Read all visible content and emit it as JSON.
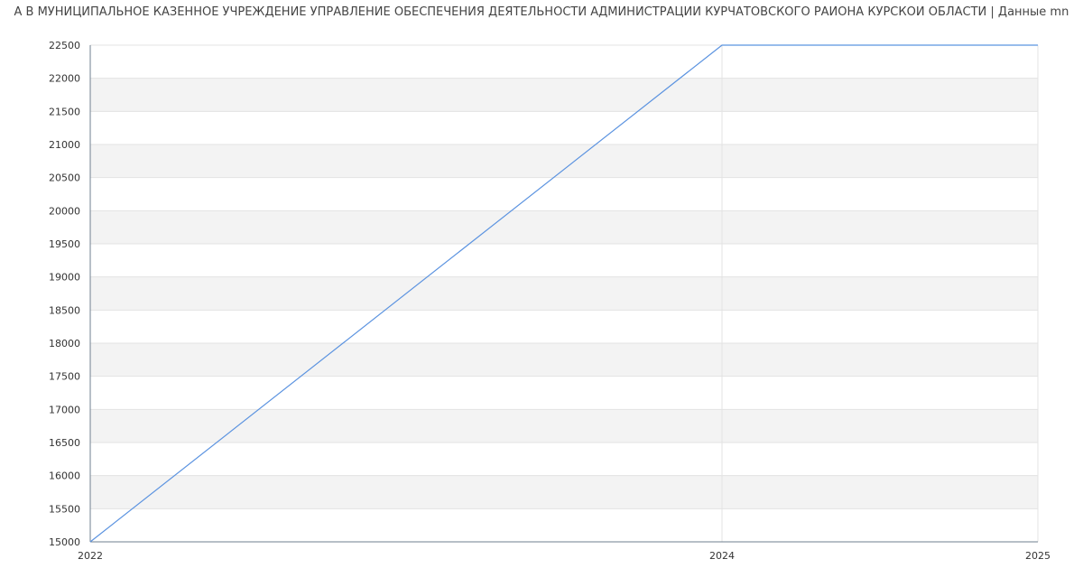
{
  "chart_data": {
    "type": "line",
    "title": "А В МУНИЦИПАЛЬНОЕ КАЗЕННОЕ УЧРЕЖДЕНИЕ УПРАВЛЕНИЕ ОБЕСПЕЧЕНИЯ ДЕЯТЕЛЬНОСТИ АДМИНИСТРАЦИИ КУРЧАТОВСКОГО РАЙОНА КУРСКОЙ ОБЛАСТИ | Данные mn",
    "xlabel": "",
    "ylabel": "",
    "x": [
      2022,
      2024,
      2025
    ],
    "x_ticks": [
      "2022",
      "2024",
      "2025"
    ],
    "series": [
      {
        "values": [
          15000,
          22500,
          22500
        ]
      }
    ],
    "xlim": [
      2022,
      2025
    ],
    "ylim": [
      15000,
      22500
    ],
    "y_ticks": [
      15000,
      15500,
      16000,
      16500,
      17000,
      17500,
      18000,
      18500,
      19000,
      19500,
      20000,
      20500,
      21000,
      21500,
      22000,
      22500
    ],
    "grid": true,
    "colors": {
      "line": "#5b93e0",
      "band": "#f3f3f3",
      "grid": "#e3e3e3",
      "axis": "#6f7f8f"
    }
  }
}
